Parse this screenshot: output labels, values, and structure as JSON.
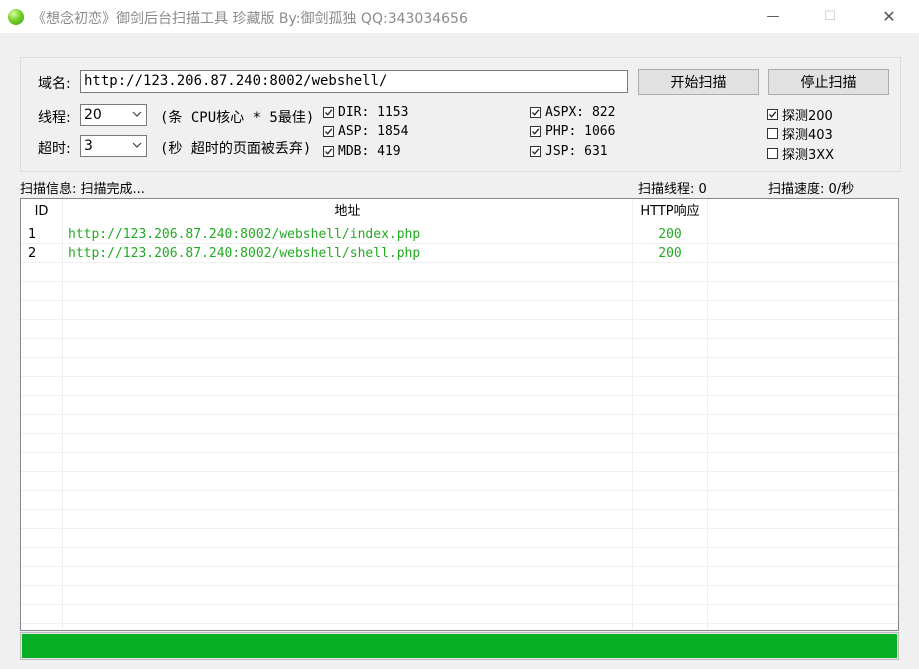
{
  "window": {
    "title": "《想念初恋》御剑后台扫描工具 珍藏版 By:御剑孤独 QQ:343034656",
    "min_glyph": "—",
    "max_glyph": "☐",
    "close_glyph": "✕"
  },
  "form": {
    "domain_label": "域名:",
    "domain_value": "http://123.206.87.240:8002/webshell/",
    "start_button": "开始扫描",
    "stop_button": "停止扫描",
    "threads_label": "线程:",
    "threads_value": "20",
    "threads_hint": "(条 CPU核心 * 5最佳)",
    "timeout_label": "超时:",
    "timeout_value": "3",
    "timeout_hint": "(秒 超时的页面被丢弃)"
  },
  "dictionaries": [
    {
      "label": "DIR: 1153",
      "checked": true
    },
    {
      "label": "ASP: 1854",
      "checked": true
    },
    {
      "label": "MDB: 419",
      "checked": true
    },
    {
      "label": "ASPX: 822",
      "checked": true
    },
    {
      "label": "PHP: 1066",
      "checked": true
    },
    {
      "label": "JSP: 631",
      "checked": true
    }
  ],
  "probes": [
    {
      "label": "探测200",
      "checked": true
    },
    {
      "label": "探测403",
      "checked": false
    },
    {
      "label": "探测3XX",
      "checked": false
    }
  ],
  "status": {
    "info": "扫描信息: 扫描完成...",
    "threads": "扫描线程: 0",
    "speed": "扫描速度: 0/秒"
  },
  "table": {
    "columns": [
      "ID",
      "地址",
      "HTTP响应"
    ],
    "rows": [
      {
        "id": "1",
        "url": "http://123.206.87.240:8002/webshell/index.php",
        "code": "200"
      },
      {
        "id": "2",
        "url": "http://123.206.87.240:8002/webshell/shell.php",
        "code": "200"
      }
    ]
  },
  "progress": {
    "percent": 100,
    "color": "#06b025"
  },
  "colors": {
    "found_url": "#22aa22"
  }
}
